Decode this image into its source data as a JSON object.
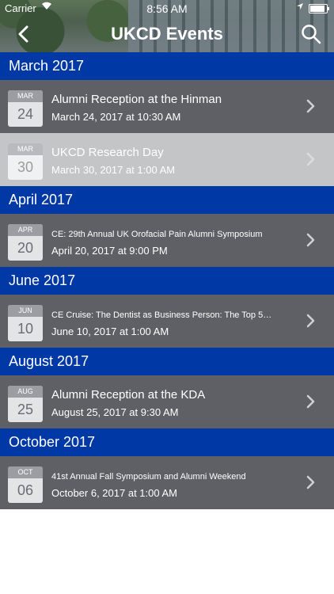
{
  "status": {
    "carrier": "Carrier",
    "time": "8:56 AM"
  },
  "header": {
    "title": "UKCD Events"
  },
  "sections": [
    {
      "month": "March 2017",
      "events": [
        {
          "cal_month": "MAR",
          "cal_day": "24",
          "title": "Alumni Reception at the Hinman",
          "date": "March 24, 2017 at 10:30 AM"
        },
        {
          "cal_month": "MAR",
          "cal_day": "30",
          "title": "UKCD Research Day",
          "date": "March 30, 2017 at 1:00 AM"
        }
      ]
    },
    {
      "month": "April 2017",
      "events": [
        {
          "cal_month": "APR",
          "cal_day": "20",
          "title": "CE: 29th Annual UK Orofacial Pain Alumni Symposium",
          "date": "April 20, 2017 at 9:00 PM"
        }
      ]
    },
    {
      "month": "June 2017",
      "events": [
        {
          "cal_month": "JUN",
          "cal_day": "10",
          "title": "CE Cruise: The Dentist as Business Person: The Top 5…",
          "date": "June 10, 2017 at 1:00 AM"
        }
      ]
    },
    {
      "month": "August 2017",
      "events": [
        {
          "cal_month": "AUG",
          "cal_day": "25",
          "title": "Alumni Reception at the KDA",
          "date": "August 25, 2017 at 9:30 AM"
        }
      ]
    },
    {
      "month": "October 2017",
      "events": [
        {
          "cal_month": "OCT",
          "cal_day": "06",
          "title": "41st Annual Fall Symposium and Alumni Weekend",
          "date": "October 6, 2017 at 1:00 AM"
        }
      ]
    }
  ]
}
